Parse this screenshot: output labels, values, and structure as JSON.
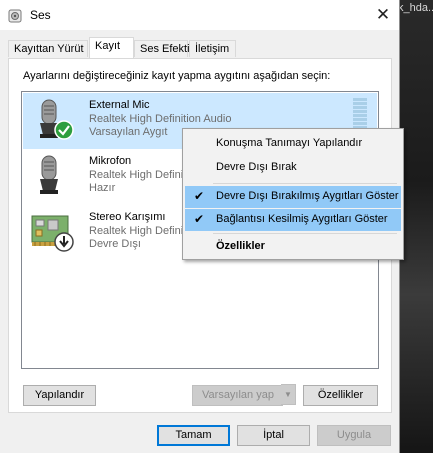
{
  "window": {
    "title": "Ses",
    "close_glyph": "✕"
  },
  "background": {
    "text": "k_hda..."
  },
  "tabs": [
    {
      "label": "Kayıttan Yürüt"
    },
    {
      "label": "Kayıt"
    },
    {
      "label": "Ses Efekti"
    },
    {
      "label": "İletişim"
    }
  ],
  "active_tab": "Kayıt",
  "instructions": "Ayarlarını değiştireceğiniz kayıt yapma aygıtını aşağıdan seçin:",
  "devices": [
    {
      "name": "External Mic",
      "driver": "Realtek High Definition Audio",
      "status": "Varsayılan Aygıt",
      "icon": "microphone-icon",
      "badge": "default-check-badge",
      "selected": true
    },
    {
      "name": "Mikrofon",
      "driver": "Realtek High Definition Audio",
      "status": "Hazır",
      "icon": "microphone-icon",
      "selected": false
    },
    {
      "name": "Stereo Karışımı",
      "driver": "Realtek High Definition Audio",
      "status": "Devre Dışı",
      "icon": "sound-card-icon",
      "badge": "disabled-down-arrow-badge",
      "selected": false
    }
  ],
  "buttons": {
    "configure": "Yapılandır",
    "set_default": "Varsayılan yap",
    "properties": "Özellikler",
    "ok": "Tamam",
    "cancel": "İptal",
    "apply": "Uygula"
  },
  "context_menu": {
    "items": [
      {
        "label": "Konuşma Tanımayı Yapılandır",
        "checked": false
      },
      {
        "label": "Devre Dışı Bırak",
        "checked": false
      },
      {
        "label": "Devre Dışı Bırakılmış Aygıtları Göster",
        "checked": true
      },
      {
        "label": "Bağlantısı Kesilmiş Aygıtları Göster",
        "checked": true
      },
      {
        "label": "Özellikler",
        "checked": false,
        "bold": true
      }
    ],
    "check_glyph": "✔"
  },
  "colors": {
    "selection": "#cce8ff",
    "menu_checked": "#91c9f7",
    "default_badge": "#2e9e3e",
    "button_default_border": "#0078d7"
  }
}
